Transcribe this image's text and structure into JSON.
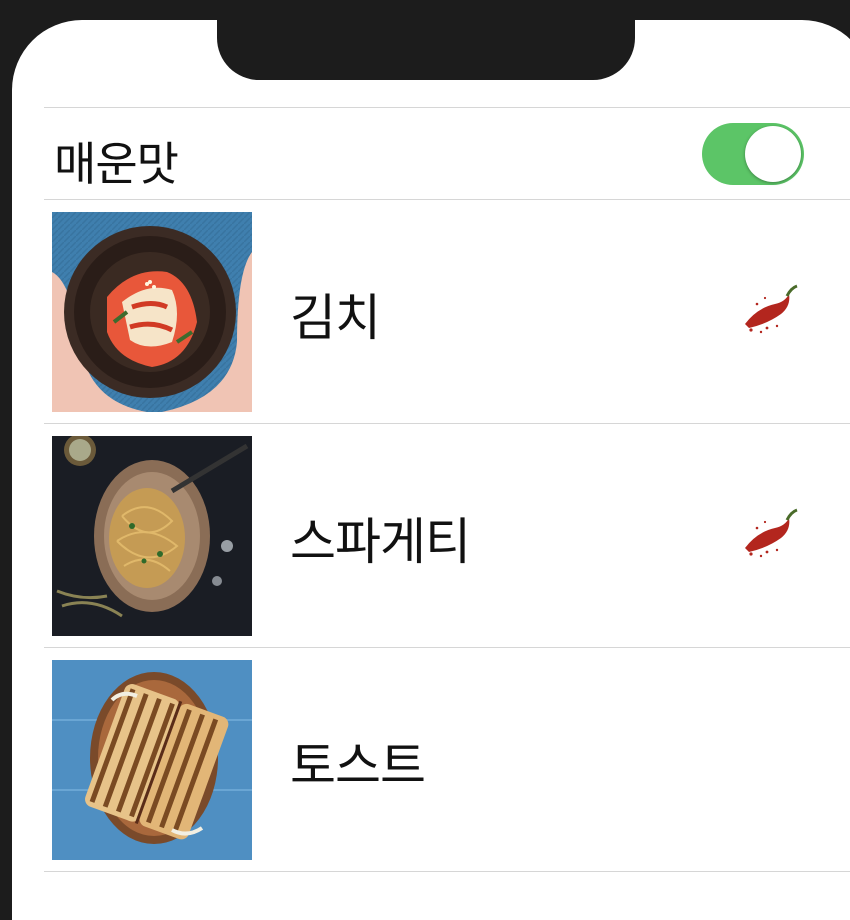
{
  "toggle": {
    "label": "매운맛",
    "on": true
  },
  "foods": [
    {
      "name": "김치",
      "spicy": true,
      "image": "kimchi-bowl-photo"
    },
    {
      "name": "스파게티",
      "spicy": true,
      "image": "spaghetti-plate-photo"
    },
    {
      "name": "토스트",
      "spicy": false,
      "image": "toast-sandwich-photo"
    }
  ],
  "colors": {
    "switch_on": "#5cc567",
    "divider": "#d6d6d6",
    "pepper": "#b3261e"
  },
  "icons": {
    "spicy": "chili-pepper-icon"
  }
}
